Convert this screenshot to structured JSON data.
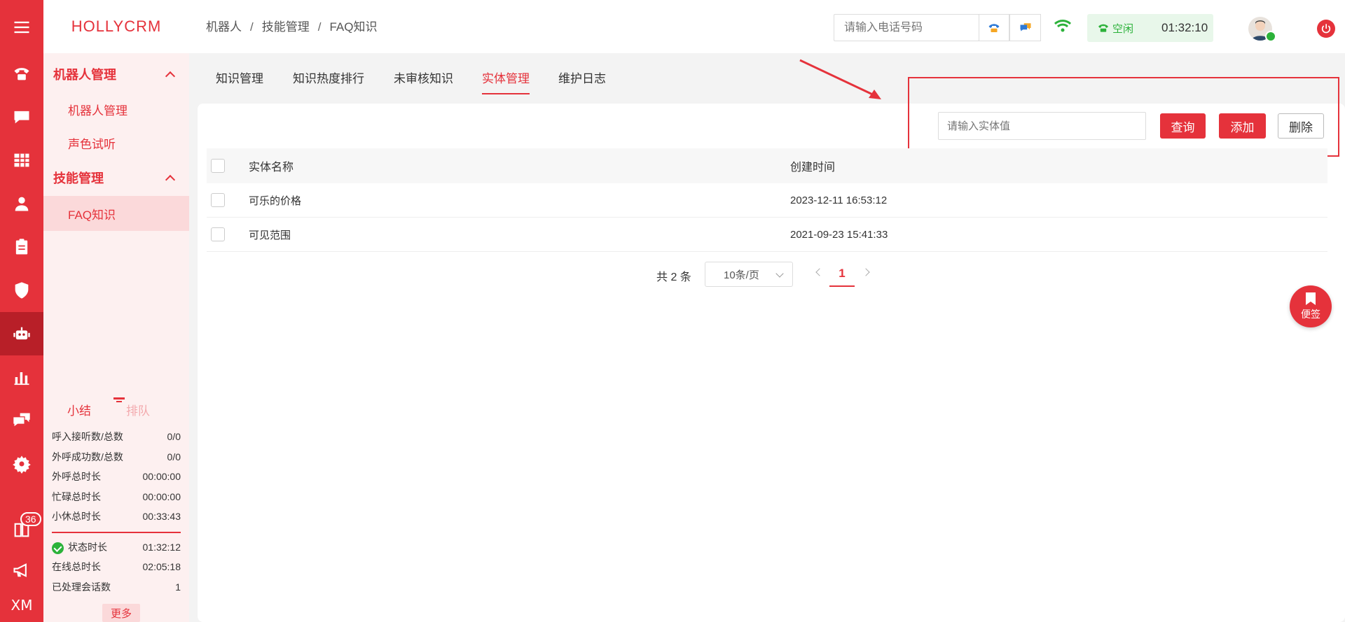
{
  "brand": "HOLLYCRM",
  "rail": {
    "badge_count": "36",
    "bottom_label": "XM"
  },
  "sidebar": {
    "groups": [
      {
        "label": "机器人管理",
        "items": [
          {
            "label": "机器人管理"
          },
          {
            "label": "声色试听"
          }
        ]
      },
      {
        "label": "技能管理",
        "items": [
          {
            "label": "FAQ知识"
          }
        ]
      }
    ]
  },
  "summary": {
    "tab_summary": "小结",
    "tab_queue": "排队",
    "rows": [
      {
        "label": "呼入接听数/总数",
        "value": "0/0"
      },
      {
        "label": "外呼成功数/总数",
        "value": "0/0"
      },
      {
        "label": "外呼总时长",
        "value": "00:00:00"
      },
      {
        "label": "忙碌总时长",
        "value": "00:00:00"
      },
      {
        "label": "小休总时长",
        "value": "00:33:43"
      }
    ],
    "rows2": [
      {
        "label": "状态时长",
        "value": "01:32:12"
      },
      {
        "label": "在线总时长",
        "value": "02:05:18"
      },
      {
        "label": "已处理会话数",
        "value": "1"
      }
    ],
    "more": "更多"
  },
  "header": {
    "breadcrumb": [
      "机器人",
      "技能管理",
      "FAQ知识"
    ],
    "phone_placeholder": "请输入电话号码",
    "status_text": "空闲",
    "status_time": "01:32:10"
  },
  "tabs": [
    {
      "label": "知识管理"
    },
    {
      "label": "知识热度排行"
    },
    {
      "label": "未审核知识"
    },
    {
      "label": "实体管理"
    },
    {
      "label": "维护日志"
    }
  ],
  "toolbar": {
    "entity_placeholder": "请输入实体值",
    "query": "查询",
    "add": "添加",
    "delete": "删除"
  },
  "table": {
    "columns": [
      "实体名称",
      "创建时间"
    ],
    "rows": [
      {
        "name": "可乐的价格",
        "created": "2023-12-11 16:53:12"
      },
      {
        "name": "可见范围",
        "created": "2021-09-23 15:41:33"
      }
    ]
  },
  "pagination": {
    "total": "共 2 条",
    "page_size": "10条/页",
    "current_page": "1"
  },
  "note_button": "便签",
  "colors": {
    "primary": "#e5323b",
    "status_green": "#2cb23a"
  }
}
